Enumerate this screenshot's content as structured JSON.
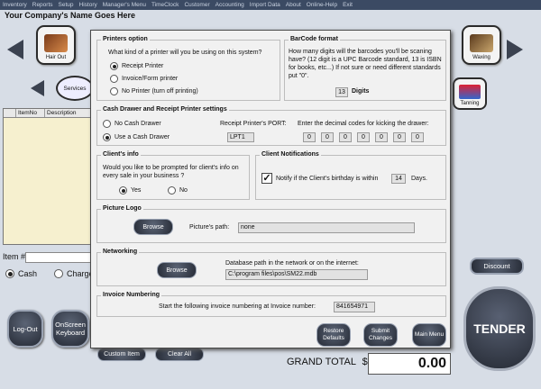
{
  "menu": [
    "Inventory",
    "Reports",
    "Setup",
    "History",
    "Manager's Menu",
    "TimeClock",
    "Customer",
    "Accounting",
    "Import Data",
    "About",
    "Online-Help",
    "Exit"
  ],
  "company_name": "Your Company's Name Goes Here",
  "categories": {
    "hair_cut": "Hair Out",
    "waxing": "Waxing",
    "services": "Services",
    "tanning": "Tanning"
  },
  "table": {
    "col_itemno": "ItemNo",
    "col_description": "Description"
  },
  "item_label": "Item #",
  "payment": {
    "cash": "Cash",
    "charge": "Charge"
  },
  "buttons": {
    "logout": "Log-Out",
    "onscreen_keyboard": "OnScreen Keyboard",
    "custom_item": "Custom Item",
    "clear_all": "Clear All",
    "discount": "Discount",
    "tender": "TENDER"
  },
  "grand_total": {
    "label": "GRAND TOTAL",
    "currency": "$",
    "value": "0.00"
  },
  "dialog": {
    "printers": {
      "title": "Printers option",
      "question": "What kind of  a printer will you be using on this system?",
      "options": [
        "Receipt Printer",
        "Invoice/Form printer",
        "No Printer (turn off printing)"
      ],
      "selected": 0
    },
    "barcode": {
      "title": "BarCode format",
      "text": "How many digits will the barcodes you'll be scaning have? (12 digit is a UPC Barcode standard, 13 is ISBN for books, etc...)  If not sure or need different standards put \"0\".",
      "digits_value": "13",
      "digits_label": "Digits"
    },
    "drawer": {
      "title": "Cash Drawer and Receipt Printer settings",
      "options": [
        "No Cash Drawer",
        "Use a Cash Drawer"
      ],
      "selected": 1,
      "port_label": "Receipt Printer's PORT:",
      "port_value": "LPT1",
      "codes_label": "Enter the decimal codes for kicking the drawer:",
      "codes": [
        "0",
        "0",
        "0",
        "0",
        "0",
        "0",
        "0"
      ]
    },
    "client_info": {
      "title": "Client's info",
      "question": "Would you like to be prompted for client's info on every sale in your business ?",
      "yes": "Yes",
      "no": "No",
      "selected": "yes"
    },
    "notifications": {
      "title": "Client Notifications",
      "text": "Notify if the Client's birthday is within",
      "days_value": "14",
      "days_label": "Days.",
      "checked": true
    },
    "logo": {
      "title": "Picture Logo",
      "browse": "Browse",
      "path_label": "Picture's path:",
      "path_value": "none"
    },
    "networking": {
      "title": "Networking",
      "browse": "Browse",
      "path_label": "Database path in the network or on the internet:",
      "path_value": "C:\\program files\\pos\\SM22.mdb"
    },
    "invoice": {
      "title": "Invoice Numbering",
      "label": "Start the following  invoice numbering at Invoice number:",
      "value": "841654971"
    },
    "footer_buttons": {
      "restore": "Restore Defaults",
      "submit": "Submit Changes",
      "main_menu": "Main Menu"
    }
  }
}
